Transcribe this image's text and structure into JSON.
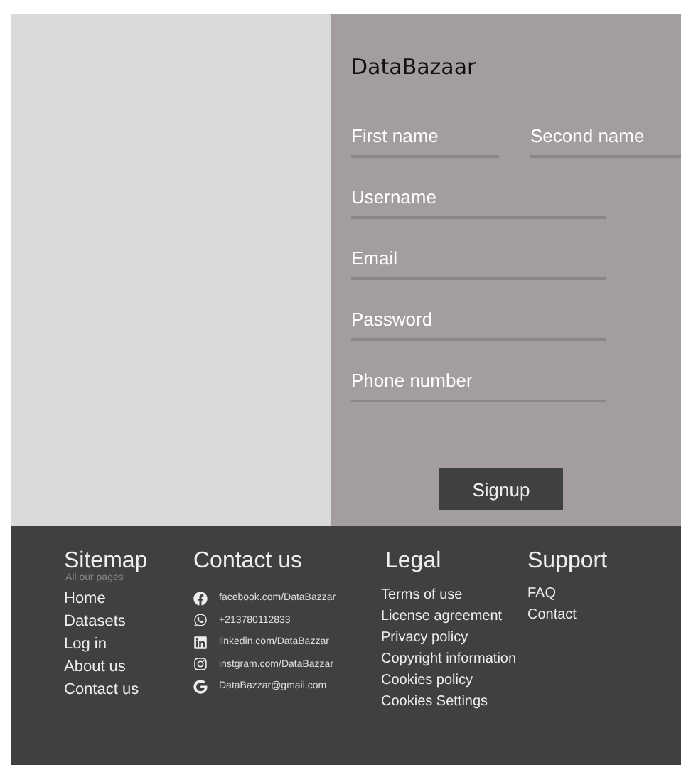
{
  "brand": "DataBazaar",
  "form": {
    "name_fields": [
      {
        "placeholder": "First name"
      },
      {
        "placeholder": "Second name"
      }
    ],
    "fields": [
      {
        "placeholder": "Username"
      },
      {
        "placeholder": "Email"
      },
      {
        "placeholder": "Password"
      },
      {
        "placeholder": "Phone number"
      }
    ],
    "submit": "Signup"
  },
  "footer": {
    "sitemap": {
      "title": "Sitemap",
      "subtitle": "All our pages",
      "links": [
        "Home",
        "Datasets",
        "Log in",
        "About us",
        "Contact us"
      ]
    },
    "contact": {
      "title": "Contact us",
      "items": [
        "facebook.com/DataBazzar",
        "+213780112833",
        "linkedin.com/DataBazzar",
        "instgram.com/DataBazzar",
        "DataBazzar@gmail.com"
      ]
    },
    "legal": {
      "title": "Legal",
      "links": [
        "Terms of use",
        "License agreement",
        "Privacy policy",
        "Copyright information",
        "Cookies policy",
        "Cookies Settings"
      ]
    },
    "support": {
      "title": "Support",
      "links": [
        "FAQ",
        "Contact"
      ]
    }
  }
}
